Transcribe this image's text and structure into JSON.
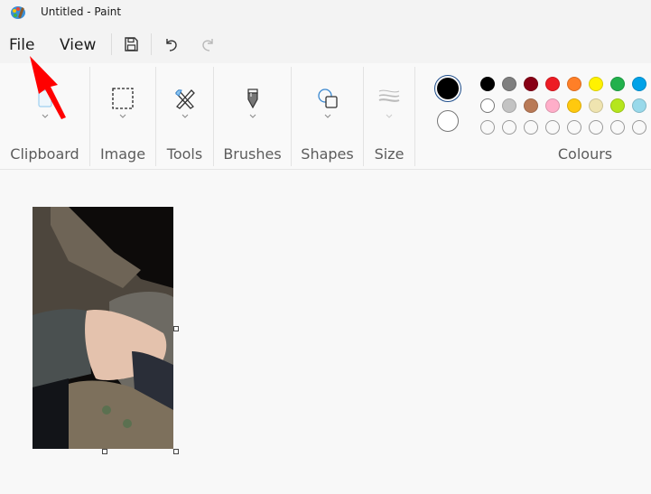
{
  "window": {
    "title": "Untitled - Paint",
    "app_icon": "paint-palette-icon"
  },
  "menubar": {
    "items": [
      "File",
      "View"
    ],
    "quick_actions": [
      {
        "name": "save",
        "icon": "save-icon"
      },
      {
        "name": "undo",
        "icon": "undo-icon"
      },
      {
        "name": "redo",
        "icon": "redo-icon",
        "disabled": true
      }
    ]
  },
  "ribbon": {
    "groups": [
      {
        "label": "Clipboard",
        "icon": "clipboard-icon"
      },
      {
        "label": "Image",
        "icon": "selection-icon"
      },
      {
        "label": "Tools",
        "icon": "tools-icon"
      },
      {
        "label": "Brushes",
        "icon": "brush-icon"
      },
      {
        "label": "Shapes",
        "icon": "shapes-icon"
      },
      {
        "label": "Size",
        "icon": "size-icon"
      }
    ],
    "colours": {
      "label": "Colours",
      "primary": "#000000",
      "secondary": "#ffffff",
      "row1": [
        "#000000",
        "#7f7f7f",
        "#880015",
        "#ed1c24",
        "#ff7f27",
        "#fff200",
        "#22b14c",
        "#00a2e8"
      ],
      "row2": [
        "#ffffff",
        "#c3c3c3",
        "#b97a57",
        "#ffaec9",
        "#ffc90e",
        "#efe4b0",
        "#b5e61d",
        "#99d9ea"
      ],
      "row3": [
        "",
        "",
        "",
        "",
        "",
        "",
        "",
        ""
      ]
    }
  },
  "annotation": {
    "arrow_color": "#ff0000",
    "points_to": "File"
  }
}
